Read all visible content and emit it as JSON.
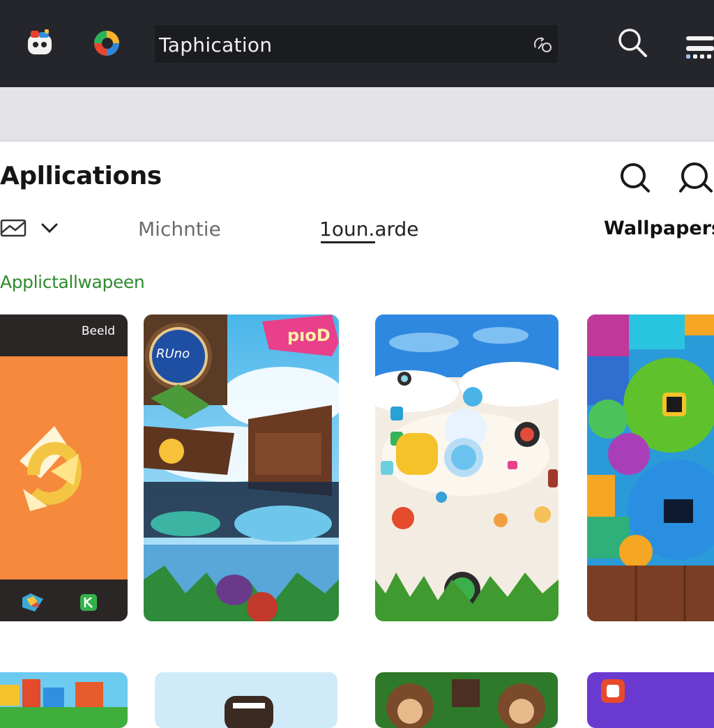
{
  "topbar": {
    "url_text": "Taphication",
    "colors": {
      "bar": "#25262b",
      "url_field": "#1b1c20"
    }
  },
  "header": {
    "title": "Apllications"
  },
  "filters": {
    "tabs": [
      {
        "label": "Michntie"
      },
      {
        "label": "1oun.arde"
      },
      {
        "label": "Wallpapers"
      }
    ],
    "active_index": 1
  },
  "section": {
    "label": "Applictallwapeen",
    "color": "#2e8b2e"
  },
  "cards": [
    {
      "badge": "Beeld",
      "art": "orange-app-icon"
    },
    {
      "badge_text": "RUno",
      "sign_text": "pıoD",
      "art": "game-scene"
    },
    {
      "art": "cloud-icons"
    },
    {
      "art": "colorful-blobs"
    }
  ],
  "icons": {
    "app1": "robot-app-icon",
    "app2": "color-wheel-app-icon",
    "url_action": "refresh-icon",
    "top_search": "search-icon",
    "top_menu": "menu-icon",
    "header_search": "search-icon",
    "header_chat": "chat-icon",
    "filter": "image-filter-icon",
    "filter_dropdown": "chevron-down-icon"
  }
}
